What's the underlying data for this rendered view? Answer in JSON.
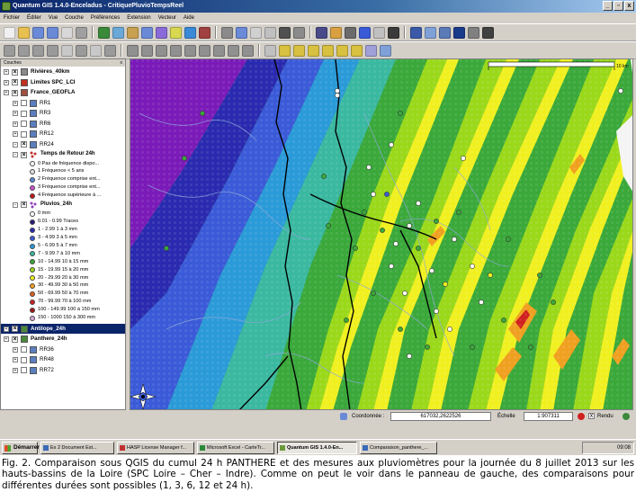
{
  "window": {
    "title": "Quantum GIS 1.4.0-Enceladus - CritiquePluvioTempsReel",
    "buttons": [
      "_",
      "▫",
      "x"
    ]
  },
  "menu": [
    "Fichier",
    "Éditer",
    "Vue",
    "Couche",
    "Préférences",
    "Extension",
    "Vecteur",
    "Aide"
  ],
  "layers_panel": {
    "title": "Couches",
    "layers": [
      {
        "label": "Rivières_40km",
        "bold": true,
        "checked": true,
        "expanded": false,
        "indent": 0,
        "icon": "polyline-layer-icon",
        "color": "#8a8a8a"
      },
      {
        "label": "Limites SPC_LCI",
        "bold": true,
        "checked": true,
        "expanded": false,
        "indent": 0,
        "icon": "polygon-layer-icon",
        "color": "#c03020"
      },
      {
        "label": "France_GEOFLA",
        "bold": true,
        "checked": true,
        "expanded": false,
        "indent": 0,
        "icon": "polygon-layer-icon",
        "color": "#a05040"
      },
      {
        "label": "RR1",
        "bold": false,
        "checked": false,
        "expanded": false,
        "indent": 1,
        "icon": "raster-layer-icon",
        "color": "#5b7fbf"
      },
      {
        "label": "RR3",
        "bold": false,
        "checked": false,
        "expanded": false,
        "indent": 1,
        "icon": "raster-layer-icon",
        "color": "#5b7fbf"
      },
      {
        "label": "RR6",
        "bold": false,
        "checked": false,
        "expanded": false,
        "indent": 1,
        "icon": "raster-layer-icon",
        "color": "#5b7fbf"
      },
      {
        "label": "RR12",
        "bold": false,
        "checked": false,
        "expanded": false,
        "indent": 1,
        "icon": "raster-layer-icon",
        "color": "#5b7fbf"
      },
      {
        "label": "RR24",
        "bold": false,
        "checked": true,
        "expanded": true,
        "indent": 1,
        "icon": "raster-layer-icon",
        "color": "#5b7fbf"
      }
    ],
    "temps_retour": {
      "label": "Temps de Retour 24h",
      "items": [
        {
          "label": "0 Pas de fréquence dispo...",
          "color": "#ffffff"
        },
        {
          "label": "1 Fréquence < 5 ans",
          "color": "#e0e0e0"
        },
        {
          "label": "2 Fréquence comprise ent...",
          "color": "#5a8ad8"
        },
        {
          "label": "3 Fréquence comprise ent...",
          "color": "#d050d0"
        },
        {
          "label": "4 Fréquence supérieure à ...",
          "color": "#c01818"
        }
      ]
    },
    "pluvios": {
      "label": "Pluvios_24h",
      "items": [
        {
          "label": "0 mm",
          "color": "#ffffff"
        },
        {
          "label": "0.01 - 0.99 Traces",
          "color": "#2a1a7a"
        },
        {
          "label": "1 - 2.99 1 à 3 mm",
          "color": "#2a2ab0"
        },
        {
          "label": "3 - 4.99 3 à 5 mm",
          "color": "#3a5ad8"
        },
        {
          "label": "5 - 6.99 5 à 7 mm",
          "color": "#2a9ad8"
        },
        {
          "label": "7 - 9.99 7 à 10 mm",
          "color": "#3ab8a0"
        },
        {
          "label": "10 - 14.99 10 à 15 mm",
          "color": "#3aa83a"
        },
        {
          "label": "15 - 19.99 15 à 20 mm",
          "color": "#9ad81a"
        },
        {
          "label": "20 - 29.99 20 à 30 mm",
          "color": "#f0f020"
        },
        {
          "label": "30 - 49.99 30 à 50 mm",
          "color": "#f0a020"
        },
        {
          "label": "50 - 69.99 50 à 70 mm",
          "color": "#e06020"
        },
        {
          "label": "70 - 99.99 70 à 100 mm",
          "color": "#d02020"
        },
        {
          "label": "100 - 149.99 100 à 150 mm",
          "color": "#a01818"
        },
        {
          "label": "150 - 1000 150 à 300 mm",
          "color": "#d8a8d8"
        }
      ]
    },
    "bottom_layers": [
      {
        "label": "Antilope_24h",
        "bold": true,
        "checked": true,
        "selected": true,
        "indent": 0
      },
      {
        "label": "Panthere_24h",
        "bold": true,
        "checked": true,
        "selected": false,
        "indent": 0
      },
      {
        "label": "RR36",
        "bold": false,
        "checked": false,
        "selected": false,
        "indent": 1
      },
      {
        "label": "RR48",
        "bold": false,
        "checked": false,
        "selected": false,
        "indent": 1
      },
      {
        "label": "RR72",
        "bold": false,
        "checked": false,
        "selected": false,
        "indent": 1
      }
    ]
  },
  "map": {
    "scalebar_label": "10 km",
    "north_arrow": "north-arrow",
    "colors": {
      "violet": "#7a1ab8",
      "blue_dark": "#2a2ab0",
      "blue": "#3a5ad8",
      "cyan": "#2a9ad8",
      "teal": "#3ab8a0",
      "green": "#3aa83a",
      "lime": "#9ad81a",
      "yellow": "#f0f020",
      "orange": "#f0a020",
      "red": "#d02020"
    }
  },
  "statusbar": {
    "coord_label": "Coordonnée :",
    "coord_value": "617032,2622526",
    "scale_label": "Échelle",
    "scale_value": "1:907311",
    "render_label": "Rendu"
  },
  "taskbar": {
    "start": "Démarrer",
    "tasks": [
      "Ex 2 Document Est...",
      "HASP License Manager f...",
      "Microsoft Excel - CarteTr...",
      "Quantum GIS 1.4.0-En...",
      "Comparaison_panthere_..."
    ],
    "active_index": 3,
    "clock": "09:08"
  },
  "caption": "Fig. 2. Comparaison sous QGIS du cumul 24 h PANTHERE et des mesures aux pluviomètres pour la journée du 8 juillet 2013 sur les hauts-bassins de la Loire (SPC Loire – Cher – Indre). Comme on peut le voir dans le panneau de gauche, des comparaisons pour différentes durées sont possibles (1, 3, 6, 12 et 24 h)."
}
